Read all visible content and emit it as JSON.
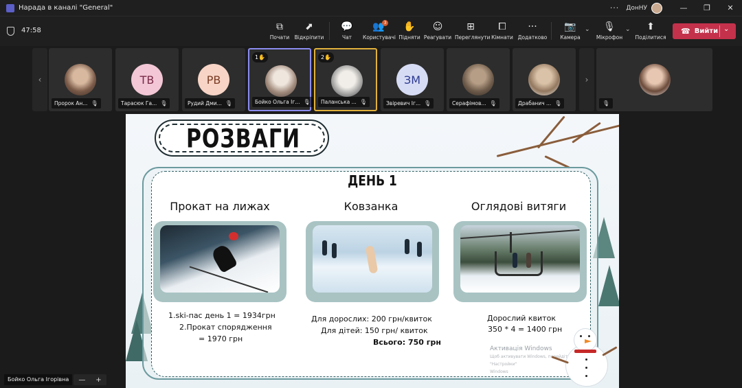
{
  "window": {
    "title": "Нарада в каналі \"General\"",
    "org": "ДонНУ",
    "dots": "···",
    "minimize": "—",
    "restore": "❐",
    "close": "✕"
  },
  "meeting": {
    "timer": "47:58"
  },
  "toolbar": {
    "items": [
      {
        "label": "Почати",
        "icon": "record-icon",
        "glyph": "⧉"
      },
      {
        "label": "Відкріпити",
        "icon": "unpin-icon",
        "glyph": "⬈"
      },
      {
        "label": "Чат",
        "icon": "chat-icon",
        "glyph": "💬"
      },
      {
        "label": "Користувачі",
        "icon": "people-icon",
        "glyph": "👥",
        "badge": "3"
      },
      {
        "label": "Підняти",
        "icon": "raise-hand-icon",
        "glyph": "✋"
      },
      {
        "label": "Реагувати",
        "icon": "react-icon",
        "glyph": "☺"
      },
      {
        "label": "Переглянути",
        "icon": "view-icon",
        "glyph": "⊞"
      },
      {
        "label": "Кімнати",
        "icon": "rooms-icon",
        "glyph": "⧠"
      },
      {
        "label": "Додатково",
        "icon": "more-icon",
        "glyph": "···"
      },
      {
        "label": "Камера",
        "icon": "camera-off-icon",
        "glyph": "📷"
      },
      {
        "label": "Мікрофон",
        "icon": "mic-off-icon",
        "glyph": "🎙"
      },
      {
        "label": "Поділитися",
        "icon": "share-icon",
        "glyph": "⬆"
      }
    ],
    "leave_label": "Вийти"
  },
  "participants": [
    {
      "name": "Пророк Ан...",
      "initials": "",
      "photo": "photo",
      "mic": "muted"
    },
    {
      "name": "Тарасюк Га...",
      "initials": "ТВ",
      "color": "#f3c7d6",
      "text_color": "#7a2a48",
      "mic": "muted"
    },
    {
      "name": "Рудий Дми...",
      "initials": "РВ",
      "color": "#f7d4c6",
      "text_color": "#7a3b23",
      "mic": "muted"
    },
    {
      "name": "Бойко Ольга Іг...",
      "initials": "",
      "photo": "photo2",
      "mic": "muted",
      "hand": "1✋",
      "highlight": "hl1"
    },
    {
      "name": "Паланська ...",
      "initials": "",
      "photo": "photo3",
      "mic": "muted",
      "hand": "2✋",
      "highlight": "hl2"
    },
    {
      "name": "Звіревич Іг...",
      "initials": "ЗМ",
      "color": "#d7dcf5",
      "text_color": "#2b3a8f",
      "mic": "muted"
    },
    {
      "name": "Серафімов...",
      "initials": "",
      "photo": "photo4",
      "mic": "muted"
    },
    {
      "name": "Драбанич ...",
      "initials": "",
      "photo": "photo5",
      "mic": "muted"
    },
    {
      "name": "",
      "initials": "",
      "photo": "photo",
      "mic": "muted"
    }
  ],
  "slide": {
    "title": "РОЗВАГИ",
    "day": "ДЕНЬ 1",
    "columns": [
      {
        "title": "Прокат на лижах",
        "lines": [
          "1.ski-пас день 1 = 1934грн",
          "2.Прокат спорядження",
          "= 1970 грн"
        ]
      },
      {
        "title": "Ковзанка",
        "lines": [
          "Для дорослих: 200 грн/квиток",
          "Для дітей: 150 грн/ квиток",
          "Всього: 750 грн"
        ]
      },
      {
        "title": "Оглядові витяги",
        "lines": [
          "Дорослий квиток",
          "350 * 4 = 1400 грн"
        ]
      }
    ],
    "watermark": {
      "title": "Активація Windows",
      "line1": "Щоб активувати Windows, перейдіть до розділу \"Настройки\"",
      "line2": "Windows"
    }
  },
  "footer": {
    "self_name": "Бойко Ольга Ігорівна",
    "zoom_out": "—",
    "zoom_in": "+"
  }
}
